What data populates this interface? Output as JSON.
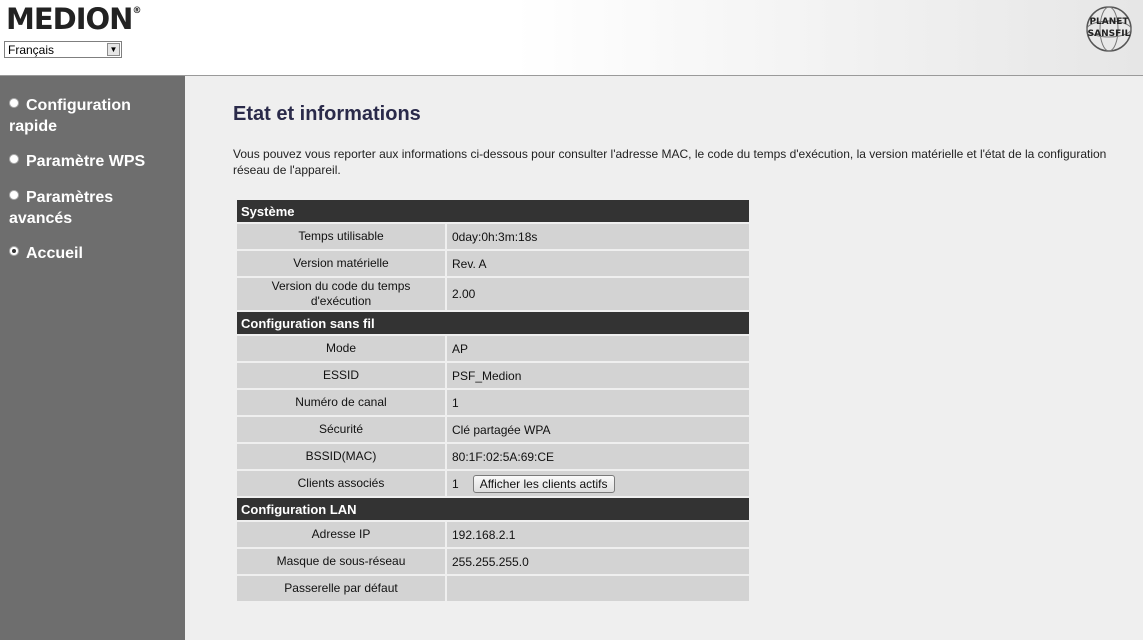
{
  "header": {
    "brand": "MEDION",
    "brand_mark": "®",
    "language_selected": "Français",
    "partner_logo_top": "PLANET",
    "partner_logo_bottom": "SANSFIL"
  },
  "sidebar": {
    "items": [
      {
        "label": "Configuration rapide",
        "active": false
      },
      {
        "label": "Paramètre WPS",
        "active": false
      },
      {
        "label": "Paramètres avancés",
        "active": false
      },
      {
        "label": "Accueil",
        "active": true
      }
    ]
  },
  "main": {
    "title": "Etat et informations",
    "intro": "Vous pouvez vous reporter aux informations ci-dessous pour consulter l'adresse MAC, le code du temps d'exécution, la version matérielle et l'état de la configuration réseau de l'appareil.",
    "sections": [
      {
        "title": "Système",
        "rows": [
          {
            "label": "Temps utilisable",
            "value": "0day:0h:3m:18s"
          },
          {
            "label": "Version matérielle",
            "value": "Rev. A"
          },
          {
            "label": "Version du code du temps d'exécution",
            "value": "2.00"
          }
        ]
      },
      {
        "title": "Configuration sans fil",
        "rows": [
          {
            "label": "Mode",
            "value": "AP"
          },
          {
            "label": "ESSID",
            "value": "PSF_Medion"
          },
          {
            "label": "Numéro de canal",
            "value": "1"
          },
          {
            "label": "Sécurité",
            "value": "Clé partagée WPA"
          },
          {
            "label": "BSSID(MAC)",
            "value": "80:1F:02:5A:69:CE"
          },
          {
            "label": "Clients associés",
            "value": "1",
            "button": "Afficher les clients actifs"
          }
        ]
      },
      {
        "title": "Configuration LAN",
        "rows": [
          {
            "label": "Adresse IP",
            "value": "192.168.2.1"
          },
          {
            "label": "Masque de sous-réseau",
            "value": "255.255.255.0"
          },
          {
            "label": "Passerelle par défaut",
            "value": ""
          }
        ]
      }
    ]
  },
  "colors": {
    "sidebar_bg": "#6e6e6e",
    "section_header_bg": "#333333",
    "row_bg": "#d3d3d3",
    "page_bg": "#efefef"
  }
}
